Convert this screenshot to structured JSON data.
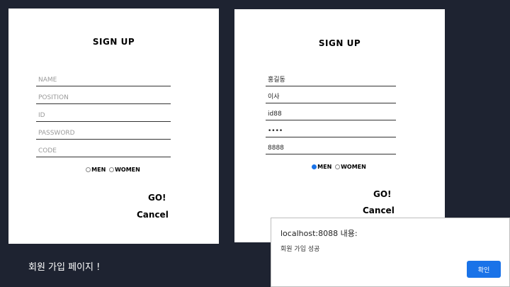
{
  "left_form": {
    "title": "SIGN UP",
    "fields": [
      {
        "placeholder": "NAME"
      },
      {
        "placeholder": "POSITION"
      },
      {
        "placeholder": "ID"
      },
      {
        "placeholder": "PASSWORD"
      },
      {
        "placeholder": "CODE"
      }
    ],
    "gender": {
      "options": [
        "MEN",
        "WOMEN"
      ],
      "selected": ""
    },
    "go_label": "GO!",
    "cancel_label": "Cancel"
  },
  "right_form": {
    "title": "SIGN UP",
    "fields": [
      {
        "value": "홍길동"
      },
      {
        "value": "이사"
      },
      {
        "value": "id88"
      },
      {
        "value": "••••"
      },
      {
        "value": "8888"
      }
    ],
    "gender": {
      "options": [
        "MEN",
        "WOMEN"
      ],
      "selected": "MEN"
    },
    "go_label": "GO!",
    "cancel_label": "Cancel"
  },
  "caption": "회원 가입 페이지 !",
  "dialog": {
    "title": "localhost:8088 내용:",
    "message": "회원 가입 성공",
    "ok_label": "확인"
  },
  "colors": {
    "background": "#1e2331",
    "accent": "#1a73e8"
  }
}
